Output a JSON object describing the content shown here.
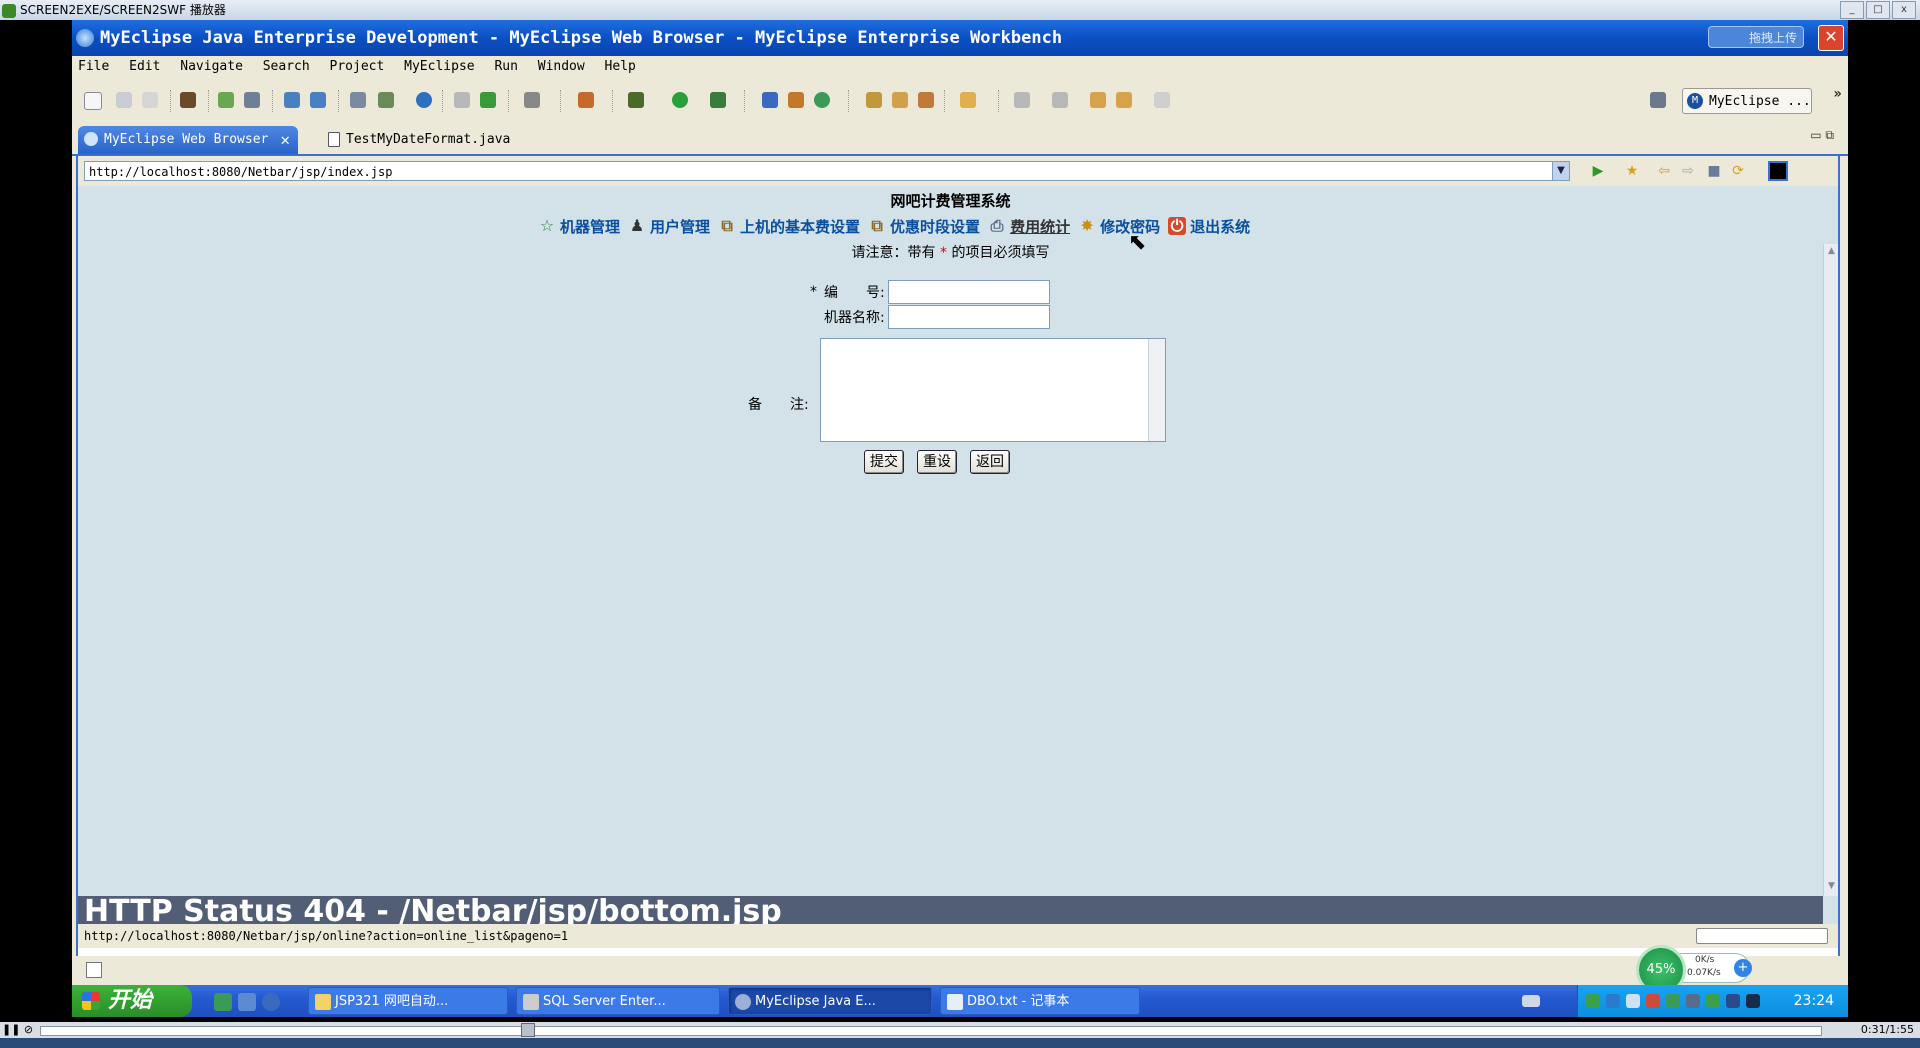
{
  "player": {
    "title": "SCREEN2EXE/SCREEN2SWF 播放器",
    "time": "0:31/1:55",
    "progress_fraction": 0.27
  },
  "window": {
    "title": "MyEclipse Java Enterprise Development - MyEclipse Web Browser - MyEclipse Enterprise Workbench",
    "upload_label": "拖拽上传",
    "close_glyph": "✕"
  },
  "menu": [
    "File",
    "Edit",
    "Navigate",
    "Search",
    "Project",
    "MyEclipse",
    "Run",
    "Window",
    "Help"
  ],
  "perspective": {
    "label": "MyEclipse ...",
    "icon": "M"
  },
  "tabs": [
    {
      "label": "MyEclipse Web Browser",
      "close": "✕"
    },
    {
      "label": "TestMyDateFormat.java"
    }
  ],
  "browser": {
    "url": "http://localhost:8080/Netbar/jsp/index.jsp",
    "status_url": "http://localhost:8080/Netbar/jsp/online?action=online_list&pageno=1"
  },
  "page": {
    "title": "网吧计费管理系统",
    "nav": [
      {
        "label": "机器管理",
        "icon": "☆"
      },
      {
        "label": "用户管理",
        "icon": "♟"
      },
      {
        "label": "上机的基本费设置",
        "icon": "⧉"
      },
      {
        "label": "优惠时段设置",
        "icon": "⧉"
      },
      {
        "label": "费用统计",
        "icon": "⎙"
      },
      {
        "label": "修改密码",
        "icon": "✸"
      },
      {
        "label": "退出系统",
        "icon": "⏻"
      }
    ],
    "note_prefix": "请注意：带有",
    "note_star": "*",
    "note_suffix": "的项目必须填写",
    "form": {
      "id_star": "*",
      "id_label": "编　　号:",
      "name_label": "机器名称:",
      "remark_label": "备　　注:",
      "id_value": "",
      "name_value": "",
      "remark_value": "",
      "submit": "提交",
      "reset": "重设",
      "back": "返回"
    },
    "error_text": "HTTP Status 404 - /Netbar/jsp/bottom.jsp"
  },
  "taskbar": {
    "start": "开始",
    "tasks": [
      {
        "label": "JSP321 网吧自动..."
      },
      {
        "label": "SQL Server Enter..."
      },
      {
        "label": "MyEclipse Java E..."
      },
      {
        "label": "DBO.txt - 记事本"
      }
    ],
    "clock": "23:24"
  },
  "netmeter": {
    "percent": "45%",
    "up": "0K/s",
    "down": "0.07K/s"
  },
  "colors": {
    "titlebar": "#0b4fc4",
    "page_bg": "#d3e2e9",
    "nav_link": "#0a4f9e",
    "error_band": "#525d76"
  }
}
